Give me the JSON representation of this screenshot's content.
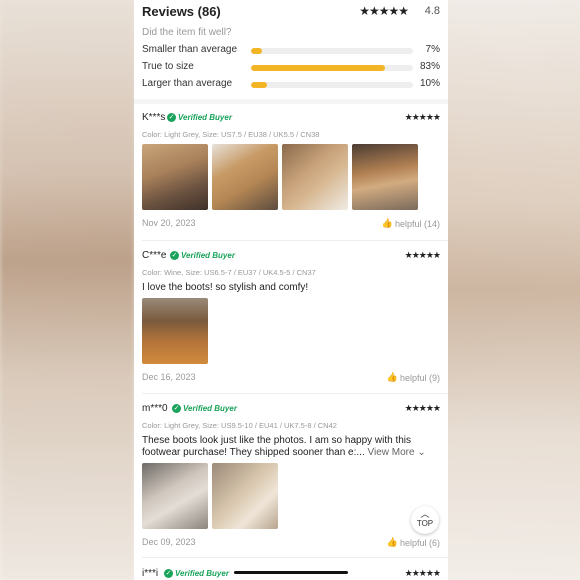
{
  "reviews_header": {
    "title": "Reviews (86)",
    "stars": "★★★★★",
    "rating": "4.8"
  },
  "fit": {
    "question": "Did the item fit well?",
    "rows": [
      {
        "label": "Smaller than average",
        "percent": "7%",
        "value": 7
      },
      {
        "label": "True to size",
        "percent": "83%",
        "value": 83
      },
      {
        "label": "Larger than average",
        "percent": "10%",
        "value": 10
      }
    ]
  },
  "verified_label": "Verified Buyer",
  "reviews": [
    {
      "name": "K***s",
      "stars": "★★★★★",
      "meta": "Color: Light Grey, Size: US7.5 / EU38 / UK5.5 / CN38",
      "date": "Nov 20, 2023",
      "helpful": "helpful (14)"
    },
    {
      "name": "C***e",
      "stars": "★★★★★",
      "meta": "Color: Wine, Size: US6.5-7 / EU37 / UK4.5-5 / CN37",
      "text": "I love the boots! so stylish and comfy!",
      "date": "Dec 16, 2023",
      "helpful": "helpful (9)"
    },
    {
      "name": "m***0",
      "stars": "★★★★★",
      "meta": "Color: Light Grey, Size: US9.5-10 / EU41 / UK7.5-8 / CN42",
      "text": "These boots look just like the photos. I am so happy with this footwear purchase! They shipped sooner than e:...",
      "view_more": "View More",
      "date": "Dec 09, 2023",
      "helpful": "helpful (6)"
    },
    {
      "name": "i***i",
      "stars": "★★★★★"
    }
  ],
  "top_button": {
    "label": "TOP"
  },
  "colors": {
    "accent": "#f2b526",
    "verified": "#1aa35b"
  }
}
